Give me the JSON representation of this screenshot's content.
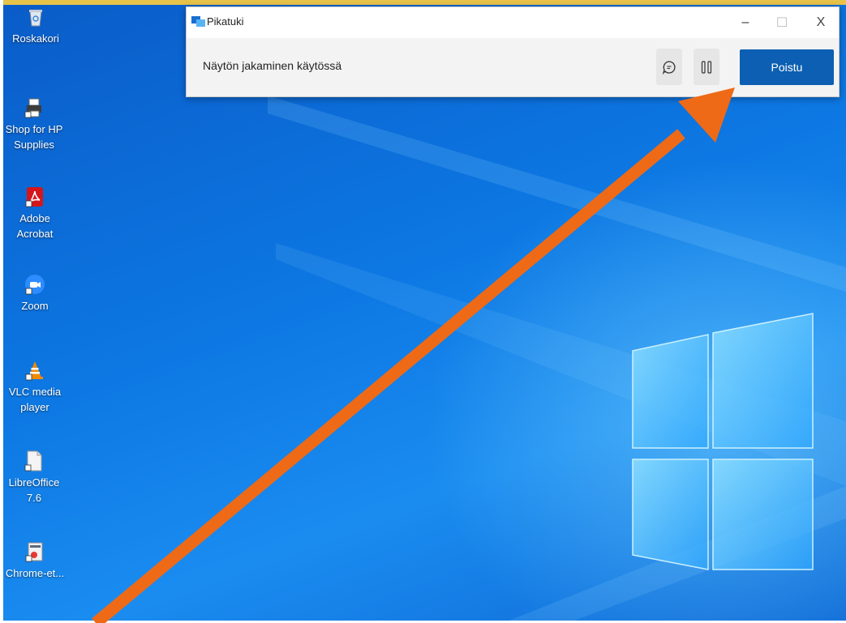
{
  "window": {
    "title": "Pikatuki",
    "status": "Näytön jakaminen käytössä",
    "exit_label": "Poistu",
    "min_glyph": "–",
    "max_glyph": "☐",
    "close_glyph": "X"
  },
  "desktop_icons": [
    {
      "label": "Roskakori",
      "icon": "recycle-bin-icon"
    },
    {
      "label": "Shop for HP Supplies",
      "icon": "hp-printer-icon"
    },
    {
      "label": "Adobe Acrobat",
      "icon": "acrobat-icon"
    },
    {
      "label": "Zoom",
      "icon": "zoom-icon"
    },
    {
      "label": "VLC media player",
      "icon": "vlc-cone-icon"
    },
    {
      "label": "LibreOffice 7.6",
      "icon": "libreoffice-icon"
    },
    {
      "label": "Chrome-et...",
      "icon": "chrome-shortcut-icon"
    }
  ],
  "colors": {
    "accent": "#0c5fb2",
    "annotation_arrow": "#ee6a17"
  }
}
